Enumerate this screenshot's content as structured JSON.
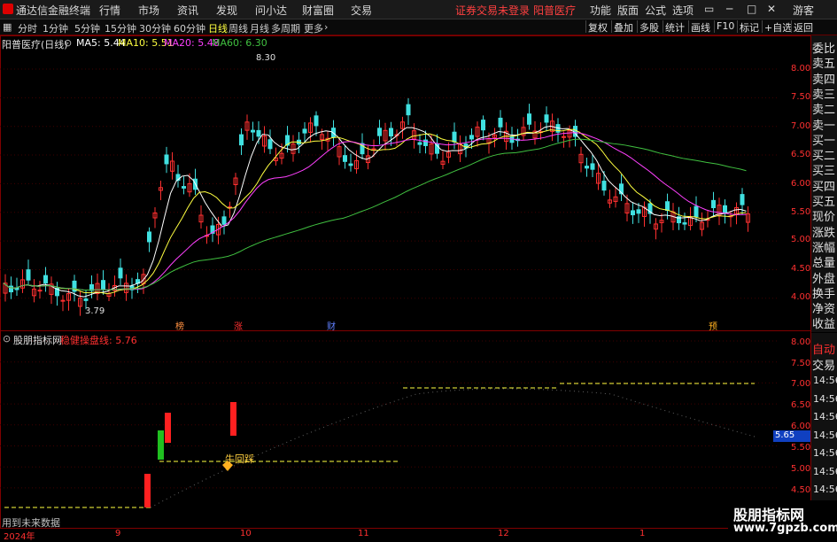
{
  "menubar": {
    "app_title": "通达信金融终端",
    "items": [
      "行情",
      "市场",
      "资讯",
      "发现",
      "问小达",
      "财富圈",
      "交易"
    ],
    "broker_status": "证券交易未登录",
    "stock_name": "阳普医疗",
    "right_items": [
      "功能",
      "版面",
      "公式",
      "选项"
    ],
    "guest": "游客"
  },
  "periodbar": {
    "periods": [
      "分时",
      "1分钟",
      "5分钟",
      "15分钟",
      "30分钟",
      "60分钟",
      "日线",
      "周线",
      "月线",
      "多周期",
      "更多"
    ],
    "selected": "日线",
    "tools": [
      "复权",
      "叠加",
      "多股",
      "统计",
      "画线",
      "F10",
      "标记",
      "+自选",
      "返回"
    ]
  },
  "main_chart": {
    "title": "阳普医疗(日线)",
    "ma5": "MA5: 5.44",
    "ma10": "MA10: 5.51",
    "ma20": "MA20: 5.48",
    "ma60": "MA60: 6.30",
    "high_label": "8.30",
    "low_label": "3.79",
    "y_ticks": [
      "8.00",
      "7.50",
      "7.00",
      "6.50",
      "6.00",
      "5.50",
      "5.00",
      "4.50",
      "4.00"
    ],
    "event_markers": [
      "榜",
      "涨",
      "财",
      "预"
    ],
    "colors": {
      "up": "#ff3030",
      "down": "#40e0e0",
      "ma5": "#ffffff",
      "ma10": "#ffff40",
      "ma20": "#ff40ff",
      "ma60": "#40c040"
    }
  },
  "indicator": {
    "name": "股朋指标网",
    "line_name": "稳健操盘线: 5.76",
    "signal_label": "牛回踩",
    "footer_text": "用到未来数据",
    "current_value": "5.65",
    "y_ticks": [
      "8.00",
      "7.50",
      "7.00",
      "6.50",
      "6.00",
      "5.50",
      "5.00",
      "4.50"
    ]
  },
  "xaxis": {
    "labels": [
      "2024年",
      "9",
      "10",
      "11",
      "12",
      "1"
    ]
  },
  "side_panel": {
    "items": [
      "委比",
      "卖五",
      "卖四",
      "卖三",
      "卖二",
      "卖一",
      "买一",
      "买二",
      "买三",
      "买四",
      "买五",
      "现价",
      "涨跌",
      "涨幅",
      "总量",
      "外盘",
      "换手",
      "净资",
      "收益"
    ],
    "lower_items": [
      "自动",
      "交易"
    ],
    "times": [
      "14:56",
      "14:56",
      "14:56",
      "14:56",
      "14:56",
      "14:56",
      "14:56",
      "14:56",
      "14:56"
    ]
  },
  "watermark": {
    "title": "股朋指标网",
    "url": "www.7gpzb.com"
  }
}
